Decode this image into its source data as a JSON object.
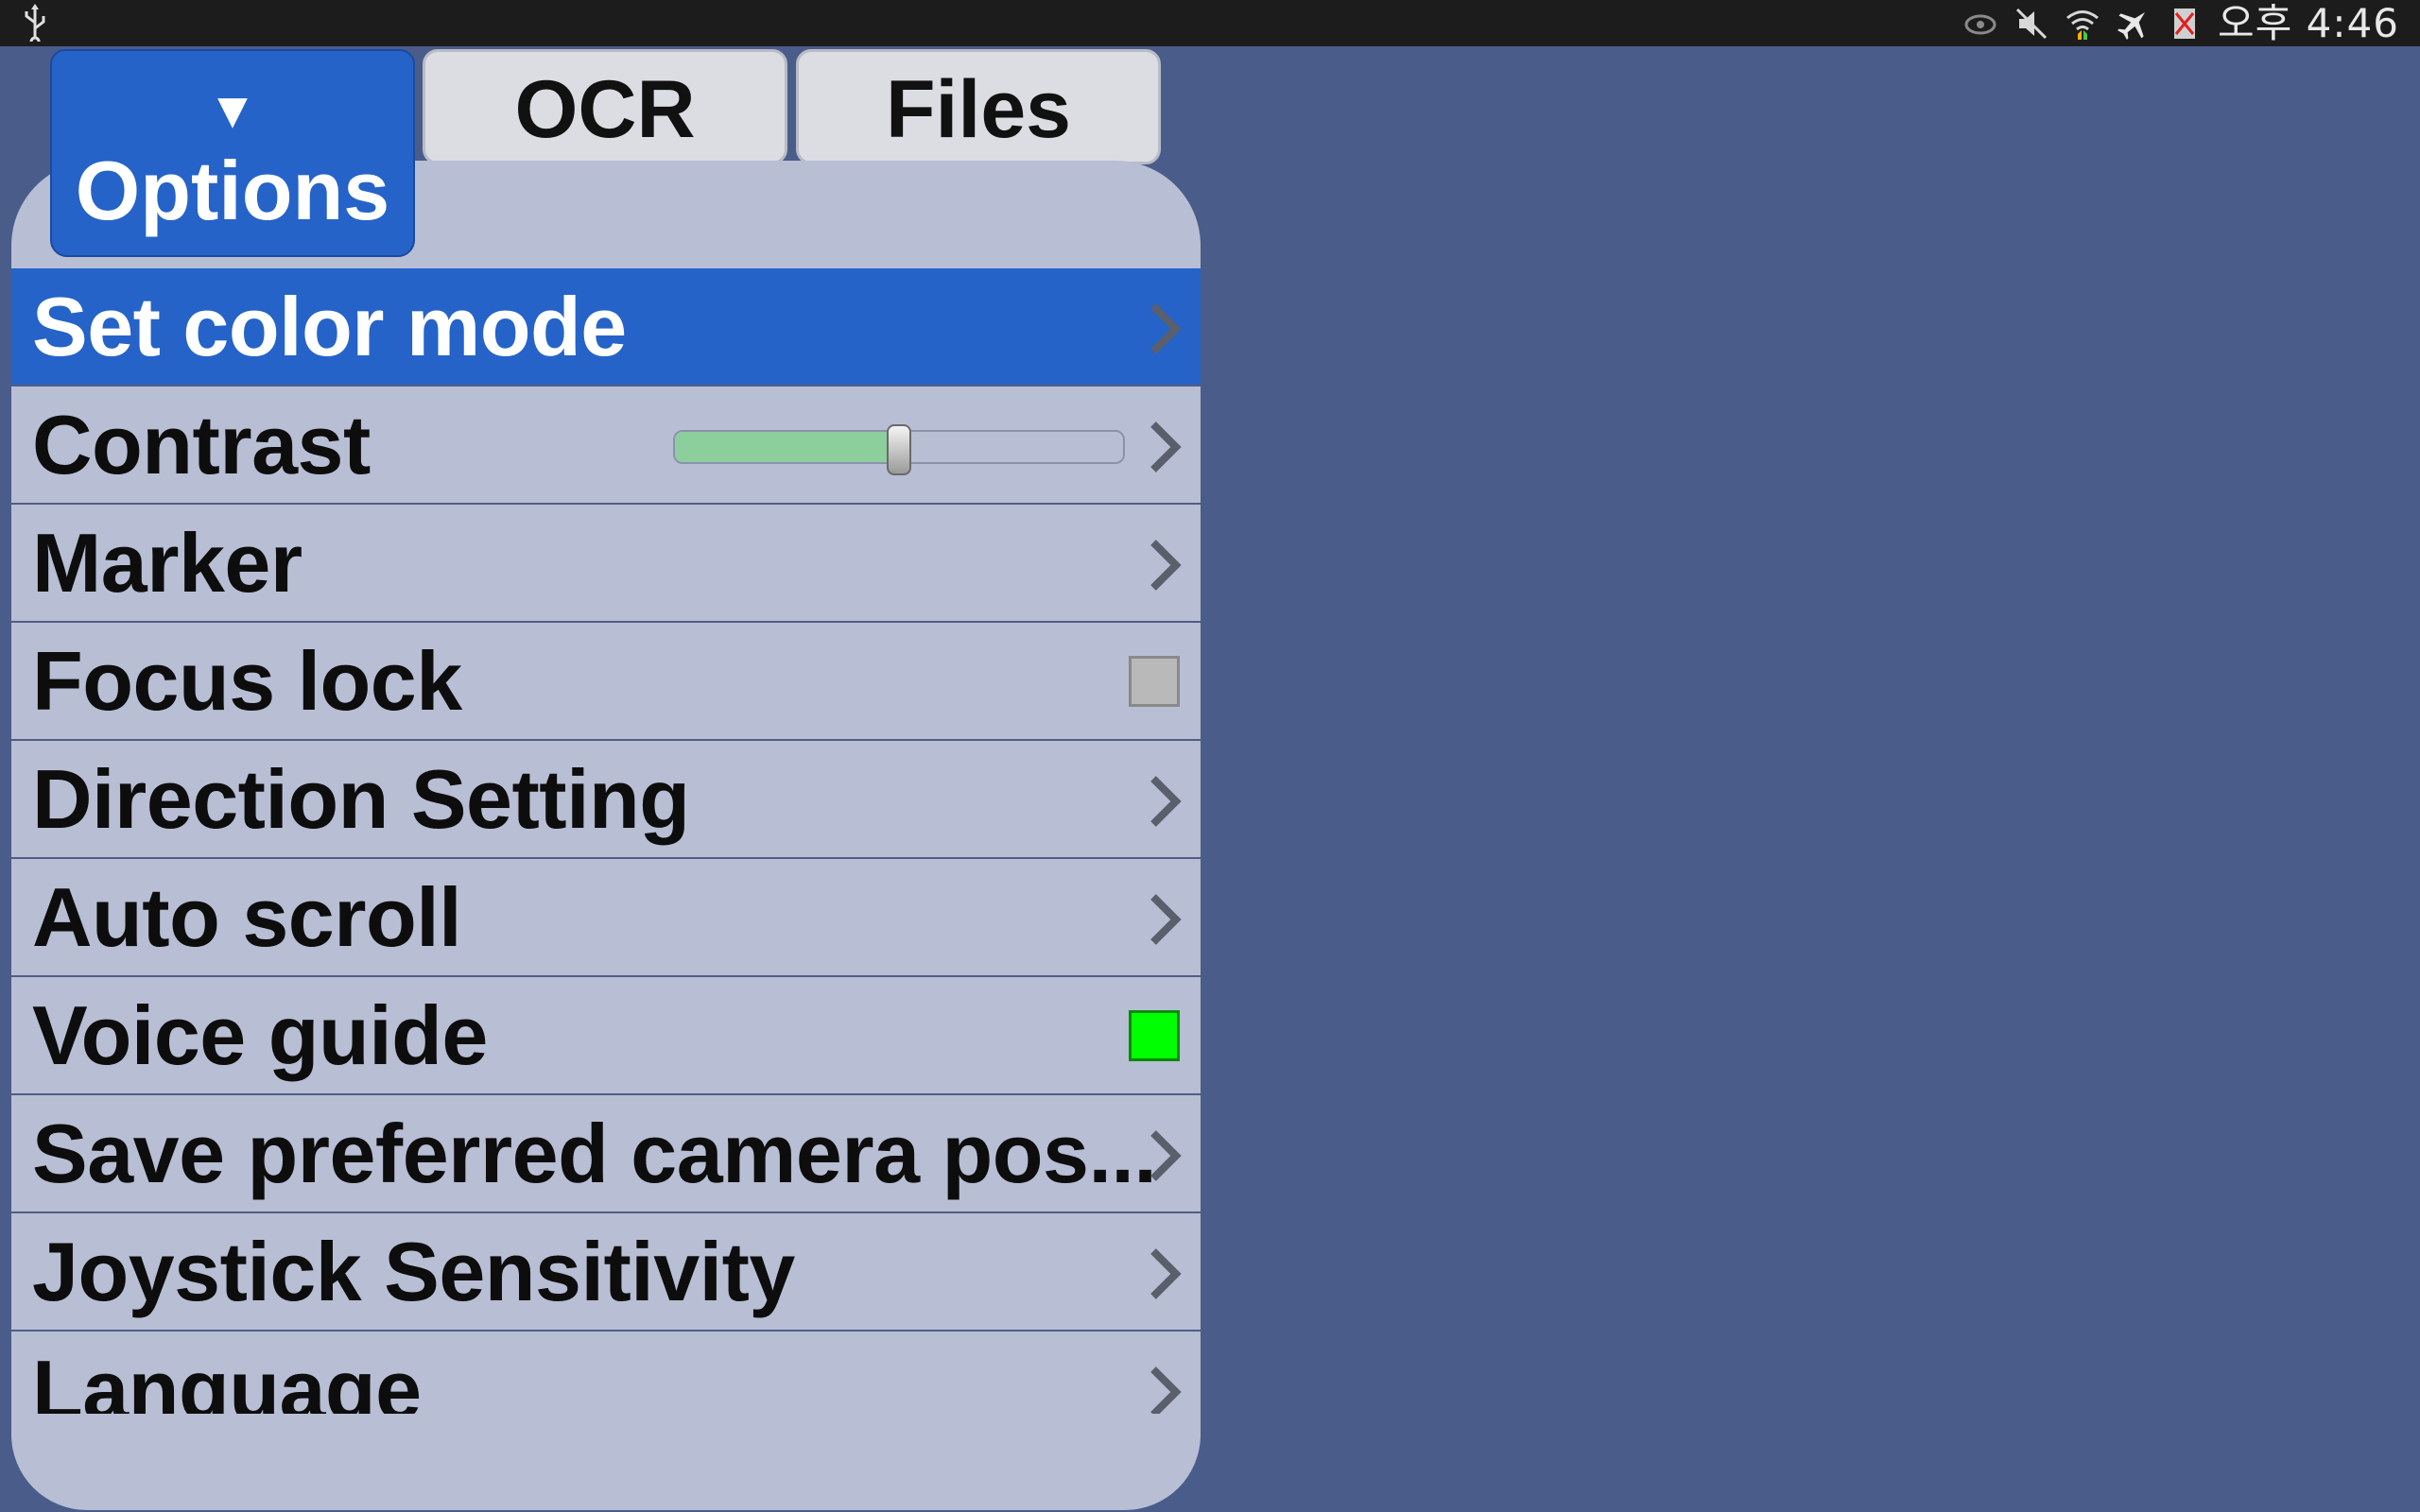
{
  "status_bar": {
    "usb_icon": "usb-icon",
    "icons": [
      "eye-icon",
      "mute-icon",
      "wifi-icon",
      "airplane-icon",
      "no-sim-icon"
    ],
    "time": "오후 4:46"
  },
  "tabs": {
    "options": {
      "arrow": "▼",
      "label": "Options"
    },
    "ocr": {
      "label": "OCR"
    },
    "files": {
      "label": "Files"
    }
  },
  "menu": {
    "items": [
      {
        "label": "Set color mode",
        "control": "chevron",
        "selected": true
      },
      {
        "label": "Contrast",
        "control": "slider",
        "value_percent": 50
      },
      {
        "label": "Marker",
        "control": "chevron"
      },
      {
        "label": "Focus lock",
        "control": "checkbox",
        "checked": false
      },
      {
        "label": "Direction Setting",
        "control": "chevron"
      },
      {
        "label": "Auto scroll",
        "control": "chevron"
      },
      {
        "label": "Voice guide",
        "control": "checkbox",
        "checked": true
      },
      {
        "label": "Save preferred camera pos...",
        "control": "chevron"
      },
      {
        "label": "Joystick Sensitivity",
        "control": "chevron"
      },
      {
        "label": "Language",
        "control": "chevron"
      }
    ]
  },
  "colors": {
    "background": "#4a5c8a",
    "accent": "#2563c8",
    "panel": "#b8bed4",
    "checkbox_on": "#00ff00",
    "slider_fill": "#8ccf9c"
  }
}
